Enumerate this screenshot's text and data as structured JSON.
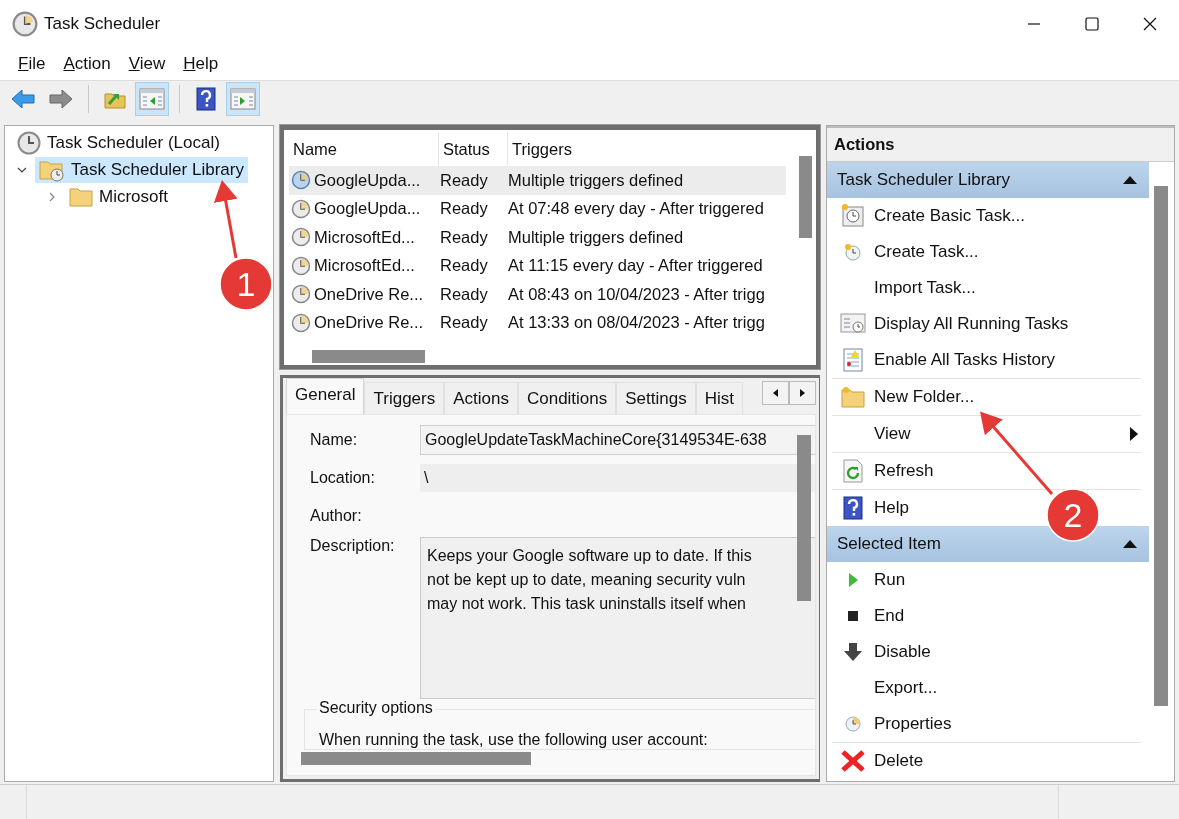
{
  "window": {
    "title": "Task Scheduler"
  },
  "menu": [
    "File",
    "Action",
    "View",
    "Help"
  ],
  "toolbar": [
    {
      "kind": "back",
      "on": false
    },
    {
      "kind": "forward",
      "on": false
    },
    {
      "kind": "up",
      "on": false
    },
    {
      "kind": "tree",
      "on": true
    },
    {
      "kind": "help",
      "on": false
    },
    {
      "kind": "pane",
      "on": true
    }
  ],
  "tree": [
    {
      "label": "Task Scheduler (Local)",
      "kind": "clock",
      "selected": false,
      "children": [
        {
          "label": "Task Scheduler Library",
          "kind": "library",
          "selected": true,
          "expanded": true,
          "children": [
            {
              "label": "Microsoft",
              "kind": "folder",
              "selected": false,
              "expanded": false
            }
          ]
        }
      ]
    }
  ],
  "tasks": {
    "columns": [
      "Name",
      "Status",
      "Triggers"
    ],
    "rows": [
      {
        "name": "GoogleUpda...",
        "status": "Ready",
        "trigger": "Multiple triggers defined",
        "selected": true
      },
      {
        "name": "GoogleUpda...",
        "status": "Ready",
        "trigger": "At 07:48 every day - After triggered",
        "selected": false
      },
      {
        "name": "MicrosoftEd...",
        "status": "Ready",
        "trigger": "Multiple triggers defined",
        "selected": false
      },
      {
        "name": "MicrosoftEd...",
        "status": "Ready",
        "trigger": "At 11:15 every day - After triggered",
        "selected": false
      },
      {
        "name": "OneDrive Re...",
        "status": "Ready",
        "trigger": "At 08:43 on 10/04/2023 - After trigg",
        "selected": false
      },
      {
        "name": "OneDrive Re...",
        "status": "Ready",
        "trigger": "At 13:33 on 08/04/2023 - After trigg",
        "selected": false
      }
    ]
  },
  "details": {
    "tabs": [
      {
        "label": "General",
        "selected": true
      },
      {
        "label": "Triggers",
        "selected": false
      },
      {
        "label": "Actions",
        "selected": false
      },
      {
        "label": "Conditions",
        "selected": false
      },
      {
        "label": "Settings",
        "selected": false
      },
      {
        "label": "Hist",
        "selected": false
      }
    ],
    "name_label": "Name:",
    "name_value": "GoogleUpdateTaskMachineCore{3149534E-638",
    "location_label": "Location:",
    "location_value": "\\",
    "author_label": "Author:",
    "description_label": "Description:",
    "description_lines": [
      "Keeps your Google software up to date. If this",
      "not be kept up to date, meaning security vuln",
      "may not work. This task uninstalls itself when"
    ],
    "security_title": "Security options",
    "security_text": "When running the task, use the following user account:"
  },
  "actions": {
    "title": "Actions",
    "sections": [
      {
        "title": "Task Scheduler Library",
        "expanded": true,
        "items": [
          {
            "label": "Create Basic Task...",
            "kind": "basic",
            "divider": false
          },
          {
            "label": "Create Task...",
            "kind": "task",
            "divider": false
          },
          {
            "label": "Import Task...",
            "kind": "none",
            "divider": false
          },
          {
            "label": "Display All Running Tasks",
            "kind": "running",
            "divider": false
          },
          {
            "label": "Enable All Tasks History",
            "kind": "history",
            "divider": true
          },
          {
            "label": "New Folder...",
            "kind": "folder",
            "divider": true
          },
          {
            "label": "View",
            "kind": "submenu",
            "divider": true
          },
          {
            "label": "Refresh",
            "kind": "refresh",
            "divider": true
          },
          {
            "label": "Help",
            "kind": "help",
            "divider": false
          }
        ]
      },
      {
        "title": "Selected Item",
        "expanded": true,
        "items": [
          {
            "label": "Run",
            "kind": "run",
            "divider": false
          },
          {
            "label": "End",
            "kind": "end",
            "divider": false
          },
          {
            "label": "Disable",
            "kind": "disable",
            "divider": false
          },
          {
            "label": "Export...",
            "kind": "none",
            "divider": false
          },
          {
            "label": "Properties",
            "kind": "properties",
            "divider": true
          },
          {
            "label": "Delete",
            "kind": "delete",
            "divider": false
          }
        ]
      }
    ]
  },
  "annotations": [
    {
      "label": "1"
    },
    {
      "label": "2"
    }
  ]
}
